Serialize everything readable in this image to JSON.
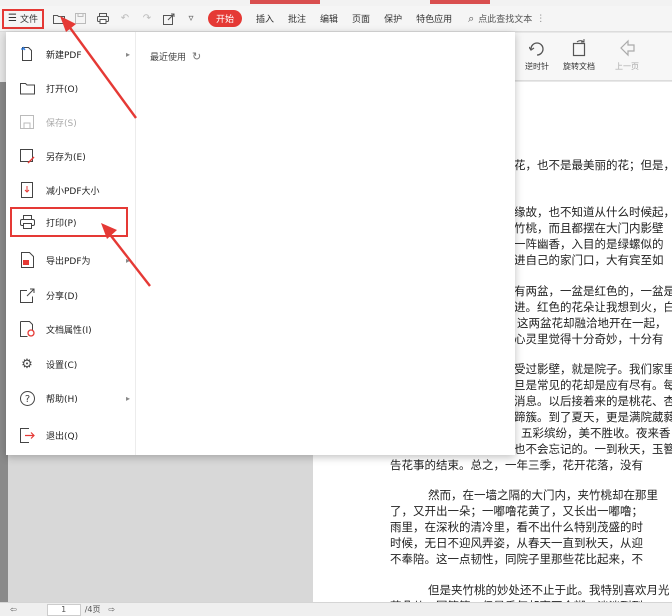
{
  "menubar": {
    "file_label": "文件",
    "items": [
      "开始",
      "插入",
      "批注",
      "编辑",
      "页面",
      "保护",
      "特色应用"
    ],
    "search_label": "点此查找文本",
    "colors": {
      "accent": "#e53935"
    }
  },
  "ribbon": {
    "rotate_ccw": "逆时针",
    "rotate_doc": "旋转文档",
    "prev_page": "上一页"
  },
  "file_menu": {
    "items": [
      {
        "label": "新建PDF",
        "icon": "new-pdf-icon",
        "arrow": true,
        "disabled": false
      },
      {
        "label": "打开(O)",
        "icon": "folder-icon",
        "arrow": false,
        "disabled": false
      },
      {
        "label": "保存(S)",
        "icon": "save-icon",
        "arrow": false,
        "disabled": true
      },
      {
        "label": "另存为(E)",
        "icon": "save-as-icon",
        "arrow": false,
        "disabled": false
      },
      {
        "label": "减小PDF大小",
        "icon": "compress-icon",
        "arrow": false,
        "disabled": false
      },
      {
        "label": "打印(P)",
        "icon": "printer-icon",
        "arrow": false,
        "disabled": false
      },
      {
        "label": "导出PDF为",
        "icon": "export-icon",
        "arrow": true,
        "disabled": false
      },
      {
        "label": "分享(D)",
        "icon": "share-icon",
        "arrow": false,
        "disabled": false
      },
      {
        "label": "文档属性(I)",
        "icon": "properties-icon",
        "arrow": false,
        "disabled": false
      },
      {
        "label": "设置(C)",
        "icon": "gear-icon",
        "arrow": false,
        "disabled": false
      },
      {
        "label": "帮助(H)",
        "icon": "help-icon",
        "arrow": true,
        "disabled": false
      },
      {
        "label": "退出(Q)",
        "icon": "exit-icon",
        "arrow": false,
        "disabled": false
      }
    ],
    "recent_label": "最近使用"
  },
  "document": {
    "lines": [
      "花，也不是最美丽的花；但是，",
      "缘故，也不知道从什么时候起，",
      "竹桃，而且都摆在大门内影壁",
      "一阵幽香，入目的是绿螺似的",
      "进自己的家门口，大有宾至如",
      "有两盆，一盆是红色的，一盆是",
      "进。红色的花朵让我想到火，白",
      "这两盆花却融洽地开在一起，",
      "心灵里觉得十分奇妙，十分有",
      "受过影壁，就是院子。我们家里",
      "旦是常见的花却是应有尽有。每",
      "消息。以后接着来的是桃花、杏",
      "蹄簇。到了夏天，更是满院葳蕤",
      "五彩缤纷，美不胜收。夜来香",
      "也不会忘记的。一到秋天，玉簪",
      "告花事的结束。总之，一年三季，花开花落，没有",
      "然而，在一墙之隔的大门内，夹竹桃却在那里",
      "了，又开出一朵；一嘟噜花黄了，又长出一嘟噜；",
      "雨里，在深秋的清冷里，看不出什么特别茂盛的时",
      "时候，无日不迎风弄姿，从春天一直到秋天，从迎",
      "不奉陪。这一点韧性，同院子里那些花比起来，不",
      "但是夹竹桃的妙处还不止于此。我特别喜欢月光",
      "花朵儿，团簇簇；但是香气却离不会糊，淡淡到到"
    ]
  },
  "status": {
    "page_value": "1",
    "page_total": "/4页"
  }
}
